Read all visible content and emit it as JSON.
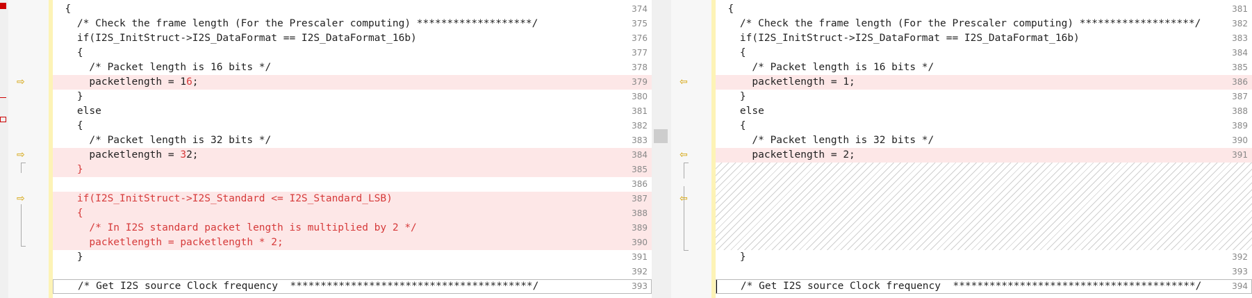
{
  "left": {
    "rows": [
      {
        "num": "374",
        "text": "  {",
        "state": "normal"
      },
      {
        "num": "375",
        "text": "    /* Check the frame length (For the Prescaler computing) *******************/",
        "state": "normal"
      },
      {
        "num": "376",
        "text": "    if(I2S_InitStruct->I2S_DataFormat == I2S_DataFormat_16b)",
        "state": "normal"
      },
      {
        "num": "377",
        "text": "    {",
        "state": "normal"
      },
      {
        "num": "378",
        "text": "      /* Packet length is 16 bits */",
        "state": "normal"
      },
      {
        "num": "379",
        "text": "      packetlength = 1",
        "red": "6",
        "tail": ";",
        "state": "changed",
        "arrow": true
      },
      {
        "num": "380",
        "text": "    }",
        "state": "normal"
      },
      {
        "num": "381",
        "text": "    else",
        "state": "normal"
      },
      {
        "num": "382",
        "text": "    {",
        "state": "normal"
      },
      {
        "num": "383",
        "text": "      /* Packet length is 32 bits */",
        "state": "normal"
      },
      {
        "num": "384",
        "text": "      packetlength = ",
        "red": "3",
        "tail": "2;",
        "state": "changed",
        "arrow": true
      },
      {
        "num": "385",
        "text": "",
        "red": "    }",
        "state": "changed"
      },
      {
        "num": "386",
        "text": "",
        "state": "normal"
      },
      {
        "num": "387",
        "text": "",
        "red": "    if(I2S_InitStruct->I2S_Standard <= I2S_Standard_LSB)",
        "state": "changed",
        "arrow": true
      },
      {
        "num": "388",
        "text": "",
        "red": "    {",
        "state": "changed"
      },
      {
        "num": "389",
        "text": "",
        "red": "      /* In I2S standard packet length is multiplied by 2 */",
        "state": "changed"
      },
      {
        "num": "390",
        "text": "",
        "red": "      packetlength = packetlength * 2;",
        "state": "changed"
      },
      {
        "num": "391",
        "text": "    }",
        "state": "normal"
      },
      {
        "num": "392",
        "text": "",
        "state": "normal"
      },
      {
        "num": "393",
        "text": "    /* Get I2S source Clock frequency  ****************************************/",
        "state": "cursor"
      }
    ]
  },
  "right": {
    "rows": [
      {
        "idx": 0,
        "num": "381",
        "text": "  {",
        "state": "normal"
      },
      {
        "idx": 1,
        "num": "382",
        "text": "    /* Check the frame length (For the Prescaler computing) *******************/",
        "state": "normal"
      },
      {
        "idx": 2,
        "num": "383",
        "text": "    if(I2S_InitStruct->I2S_DataFormat == I2S_DataFormat_16b)",
        "state": "normal"
      },
      {
        "idx": 3,
        "num": "384",
        "text": "    {",
        "state": "normal"
      },
      {
        "idx": 4,
        "num": "385",
        "text": "      /* Packet length is 16 bits */",
        "state": "normal"
      },
      {
        "idx": 5,
        "num": "386",
        "text": "      packetlength = 1;",
        "state": "changed",
        "arrow": true
      },
      {
        "idx": 6,
        "num": "387",
        "text": "    }",
        "state": "normal"
      },
      {
        "idx": 7,
        "num": "388",
        "text": "    else",
        "state": "normal"
      },
      {
        "idx": 8,
        "num": "389",
        "text": "    {",
        "state": "normal"
      },
      {
        "idx": 9,
        "num": "390",
        "text": "      /* Packet length is 32 bits */",
        "state": "normal"
      },
      {
        "idx": 10,
        "num": "391",
        "text": "      packetlength = 2;",
        "state": "changed",
        "arrow": true
      },
      {
        "idx": 17,
        "num": "392",
        "text": "    }",
        "state": "normal"
      },
      {
        "idx": 18,
        "num": "393",
        "text": "",
        "state": "normal"
      },
      {
        "idx": 19,
        "num": "394",
        "text": "    /* Get I2S source Clock frequency  ****************************************/",
        "state": "cursor"
      }
    ],
    "gap_arrow_idx": 13
  },
  "colors": {
    "changed_bg": "#fde7e7",
    "changed_text": "#d63a3a",
    "marker": "#d3a000",
    "modified_bar": "#fdf3b6"
  },
  "icons": {
    "diff_arrow_right": "arrow-right-icon",
    "diff_arrow_left": "arrow-left-icon"
  }
}
